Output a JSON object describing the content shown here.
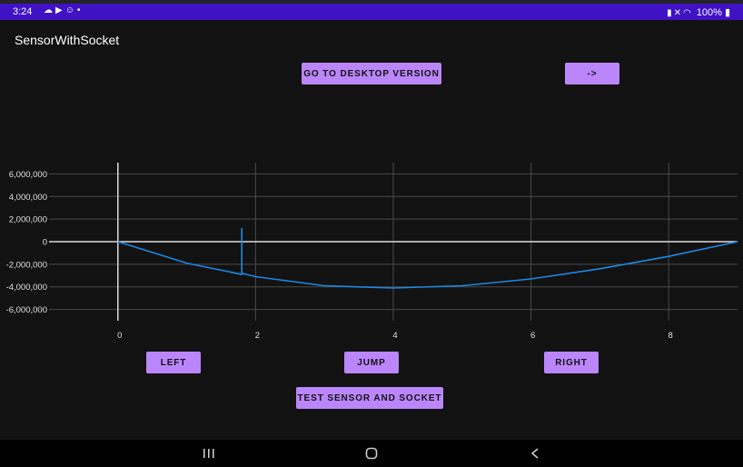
{
  "status_bar": {
    "time": "3:24",
    "notification_icons": [
      "weather-icon",
      "youtube-icon",
      "smile-icon",
      "dot-icon"
    ],
    "system_icons": [
      "battery-saver-icon",
      "mute-icon",
      "wifi-icon"
    ],
    "battery_level": "100%"
  },
  "app": {
    "title": "SensorWithSocket"
  },
  "buttons": {
    "desktop": "GO TO DESKTOP VERSION",
    "arrow": "->",
    "left": "LEFT",
    "jump": "JUMP",
    "right": "RIGHT",
    "test": "TEST SENSOR AND SOCKET"
  },
  "chart_data": {
    "type": "line",
    "title": "",
    "xlabel": "",
    "ylabel": "",
    "xlim": [
      -1,
      9
    ],
    "ylim": [
      -7000000,
      7000000
    ],
    "x_ticks": [
      0,
      2,
      4,
      6,
      8
    ],
    "y_ticks": [
      6000000,
      4000000,
      2000000,
      0,
      -2000000,
      -4000000,
      -6000000
    ],
    "x_tick_labels": [
      "0",
      "2",
      "4",
      "6",
      "8"
    ],
    "y_tick_labels": [
      "6,000,000",
      "4,000,000",
      "2,000,000",
      "0",
      "-2,000,000",
      "-4,000,000",
      "-6,000,000"
    ],
    "grid": true,
    "line_color": "#1e88e5",
    "series": [
      {
        "x": [
          0,
          1,
          1.8,
          1.8,
          1.8,
          2,
          3,
          4,
          5,
          6,
          7,
          8,
          9
        ],
        "y": [
          0,
          -1900000,
          -2900000,
          1200000,
          -2800000,
          -3100000,
          -3900000,
          -4100000,
          -3900000,
          -3300000,
          -2400000,
          -1300000,
          0
        ]
      }
    ]
  }
}
